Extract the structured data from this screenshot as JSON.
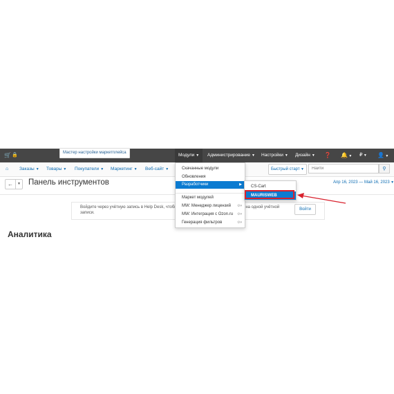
{
  "topbar": {
    "wizard_label": "Мастер настройки маркетплейса",
    "items": [
      {
        "label": "Модули"
      },
      {
        "label": "Администрирование"
      },
      {
        "label": "Настройки"
      },
      {
        "label": "Дизайн"
      }
    ],
    "currency": "₽",
    "cart_icon": "cart-icon",
    "lock_icon": "lock-icon",
    "help_icon": "help-icon",
    "bell_icon": "bell-icon",
    "user_icon": "user-icon"
  },
  "subnav": {
    "home_icon": "home-icon",
    "items": [
      {
        "label": "Заказы"
      },
      {
        "label": "Товары"
      },
      {
        "label": "Покупатели"
      },
      {
        "label": "Маркетинг"
      },
      {
        "label": "Веб-сайт"
      }
    ],
    "quick_start": "Быстрый старт",
    "search_placeholder": "Найти",
    "search_icon": "search-icon"
  },
  "page": {
    "title": "Панель инструментов",
    "date_range": "Апр 16, 2023 — Май 16, 2023",
    "notice_line1": "Войдите через учётную запись в Help Desk, чтобы",
    "notice_line1_tail": "rt на одной учётной",
    "notice_line2": "записи.",
    "login_button": "Войти",
    "analytics_heading": "Аналитика"
  },
  "modules_menu": {
    "items": [
      {
        "label": "Скачанные модули"
      },
      {
        "label": "Обновления"
      },
      {
        "label": "Разработчики",
        "active": true
      },
      {
        "label": "Маркет модулей"
      },
      {
        "label": "MW: Менеджер лицензий"
      },
      {
        "label": "MW: Интеграция с Ozon.ru"
      },
      {
        "label": "Генерация фильтров"
      }
    ]
  },
  "developers_submenu": {
    "items": [
      {
        "label": "CS-Cart"
      },
      {
        "label": "MAURISWEB",
        "active": true
      }
    ]
  },
  "colors": {
    "topbar": "#464646",
    "accent": "#0b7bd1",
    "link": "#0b6bb2",
    "highlight": "#d8212d"
  }
}
